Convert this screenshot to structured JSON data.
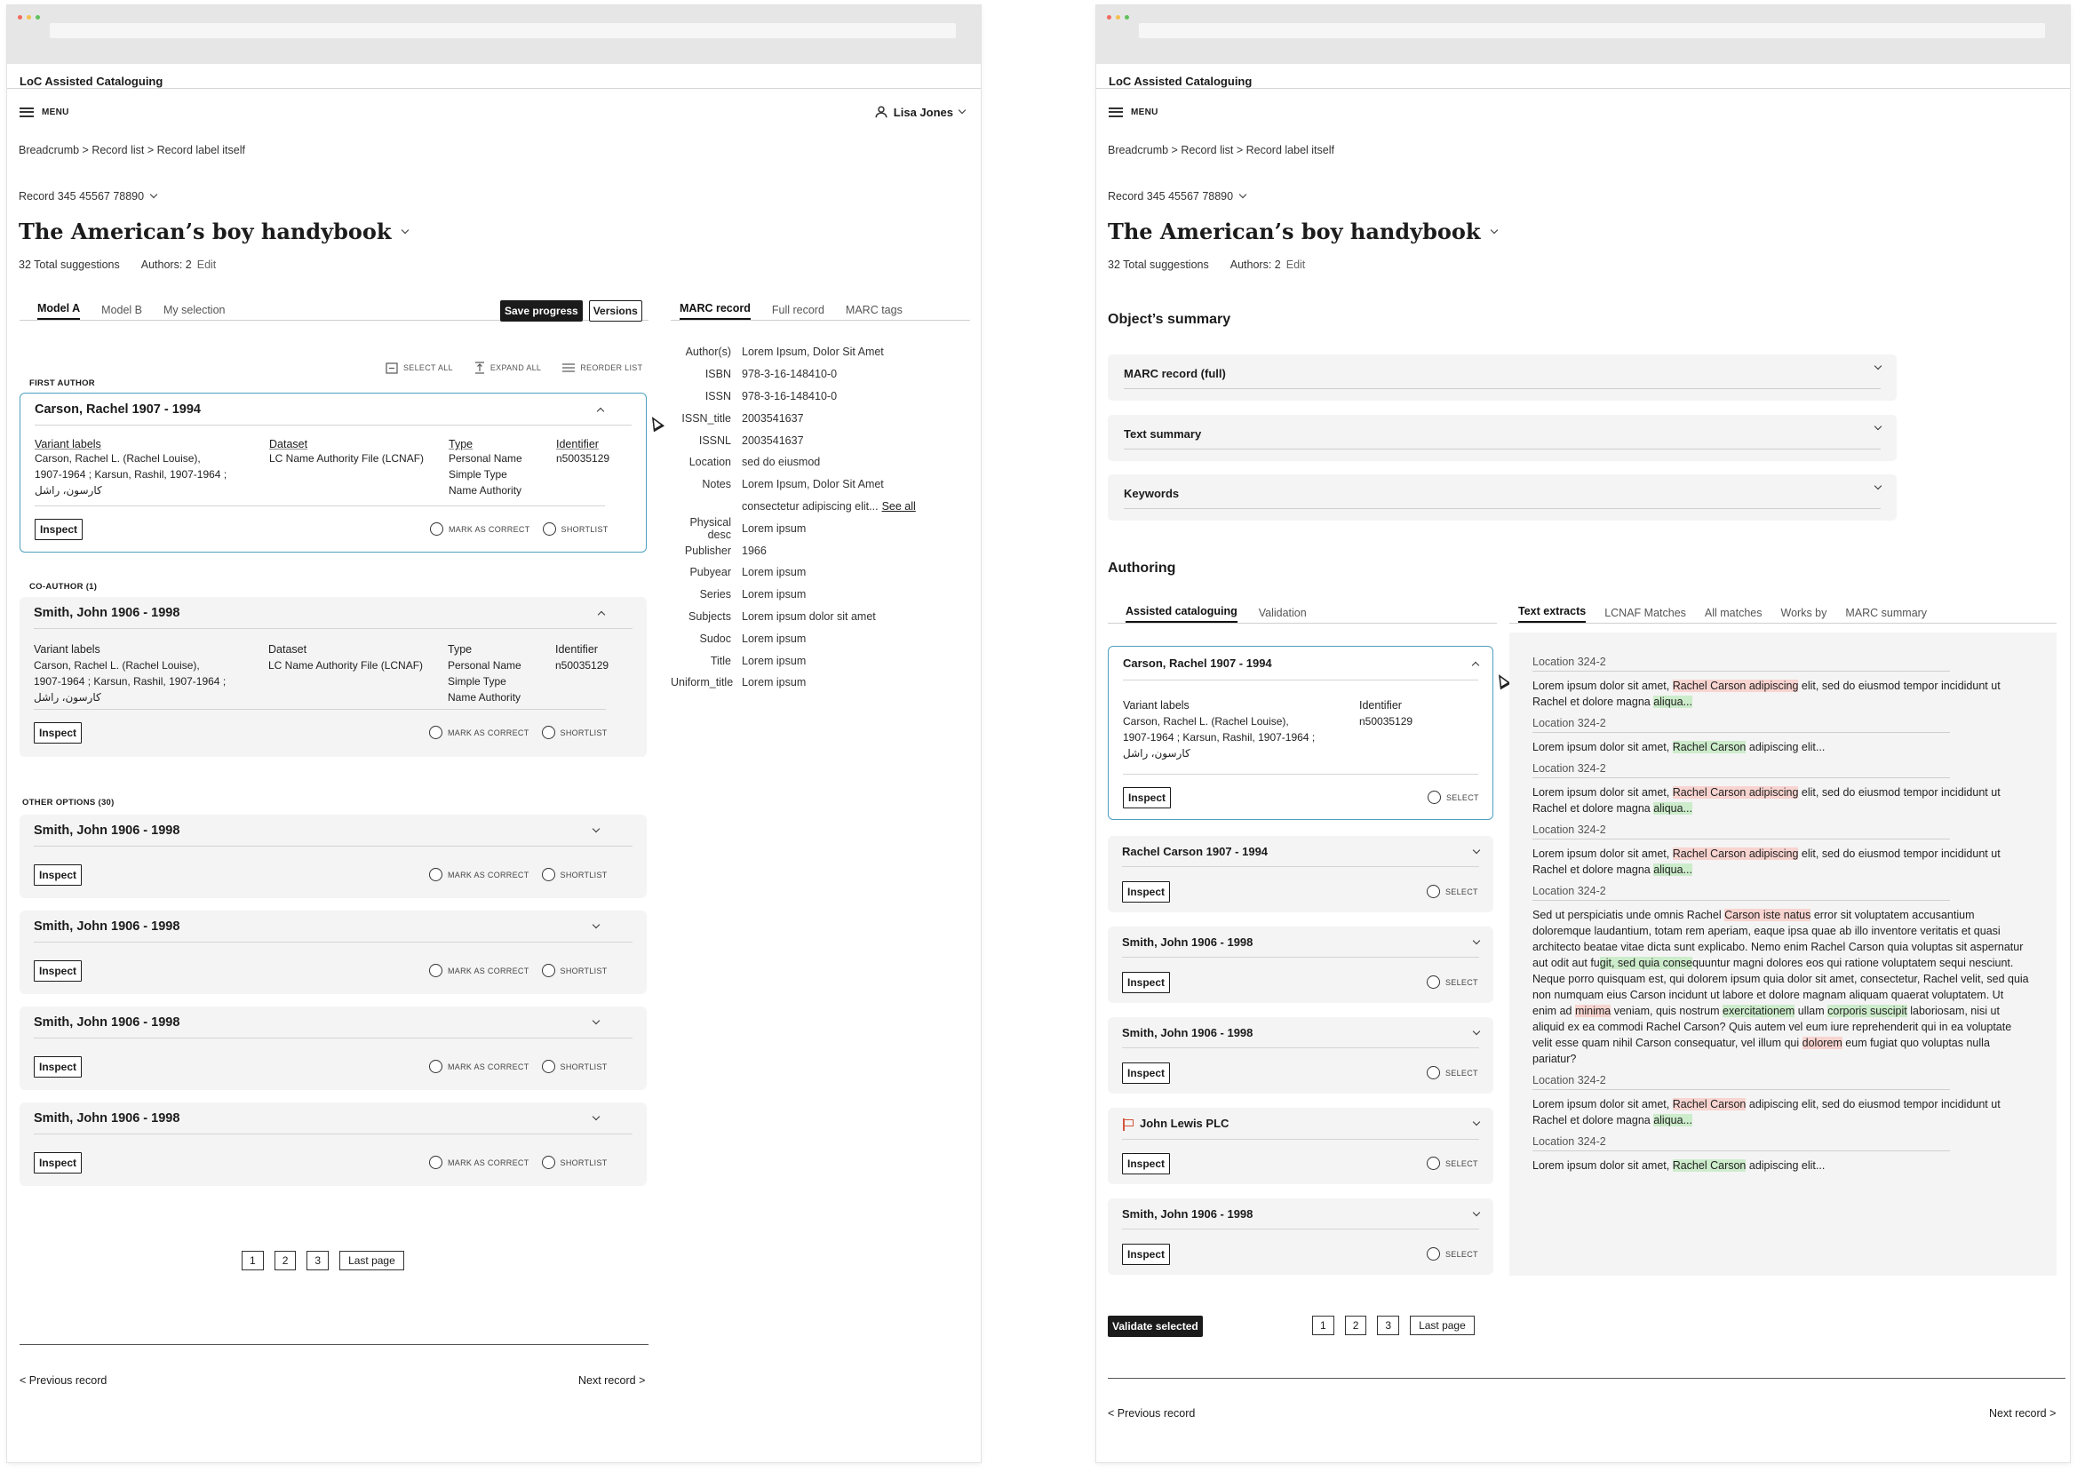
{
  "app": {
    "title": "LoC Assisted Cataloguing",
    "menu_label": "MENU",
    "user_name": "Lisa Jones"
  },
  "breadcrumb": "Breadcrumb > Record list > Record label itself",
  "record": {
    "id": "Record 345 45567 78890",
    "title": "The American’s boy handybook",
    "total_suggestions": "32 Total suggestions",
    "authors": "Authors: 2",
    "edit_label": "Edit"
  },
  "left": {
    "tabs": [
      "Model A",
      "Model B",
      "My selection"
    ],
    "save_progress": "Save progress",
    "versions": "Versions",
    "toolbar": {
      "select_all": "SELECT ALL",
      "expand_all": "EXPAND ALL",
      "reorder_list": "REORDER LIST"
    },
    "first_author_label": "FIRST AUTHOR",
    "coauthor_label": "CO-AUTHOR (1)",
    "other_options_label": "OTHER OPTIONS (30)",
    "field_headers": {
      "variant": "Variant labels",
      "dataset": "Dataset",
      "type": "Type",
      "identifier": "Identifier"
    },
    "detail_cards": [
      {
        "name": "Carson, Rachel 1907 - 1994",
        "variant_lines": [
          "Carson, Rachel L. (Rachel Louise),",
          "1907-1964 ; Karsun, Rashil, 1907-1964 ;",
          "كارسون، راشل"
        ],
        "dataset": "LC Name Authority File (LCNAF)",
        "type_lines": [
          "Personal Name",
          "Simple Type",
          "Name Authority"
        ],
        "identifier": "n50035129"
      },
      {
        "name": "Smith, John 1906 - 1998",
        "variant_lines": [
          "Carson, Rachel L. (Rachel Louise),",
          "1907-1964 ; Karsun, Rashil, 1907-1964 ;",
          "كارسون، راشل"
        ],
        "dataset": "LC Name Authority File (LCNAF)",
        "type_lines": [
          "Personal Name",
          "Simple Type",
          "Name Authority"
        ],
        "identifier": "n50035129"
      }
    ],
    "other_cards": [
      "Smith, John 1906 - 1998",
      "Smith, John 1906 - 1998",
      "Smith, John 1906 - 1998",
      "Smith, John 1906 - 1998"
    ],
    "inspect": "Inspect",
    "mark_correct": "MARK AS CORRECT",
    "shortlist": "SHORTLIST",
    "pages": [
      "1",
      "2",
      "3"
    ],
    "last_page": "Last page",
    "prev_record": "< Previous record",
    "next_record": "Next record >",
    "marc_tabs": [
      "MARC record",
      "Full record",
      "MARC tags"
    ],
    "marc_rows": [
      {
        "k": "Author(s)",
        "v": "Lorem Ipsum, Dolor Sit Amet"
      },
      {
        "k": "ISBN",
        "v": "978-3-16-148410-0"
      },
      {
        "k": "ISSN",
        "v": "978-3-16-148410-0"
      },
      {
        "k": "ISSN_title",
        "v": "2003541637"
      },
      {
        "k": "ISSNL",
        "v": "2003541637"
      },
      {
        "k": "Location",
        "v": "sed do eiusmod"
      },
      {
        "k": "Notes",
        "v": "Lorem Ipsum, Dolor Sit Amet"
      },
      {
        "k": "",
        "v": "consectetur adipiscing elit...",
        "link": "See all"
      },
      {
        "k": "Physical desc",
        "v": "Lorem ipsum"
      },
      {
        "k": "Publisher",
        "v": "1966"
      },
      {
        "k": "Pubyear",
        "v": "Lorem ipsum"
      },
      {
        "k": "Series",
        "v": "Lorem ipsum"
      },
      {
        "k": "Subjects",
        "v": "Lorem ipsum dolor sit amet"
      },
      {
        "k": "Sudoc",
        "v": "Lorem ipsum"
      },
      {
        "k": "Title",
        "v": "Lorem ipsum"
      },
      {
        "k": "Uniform_title",
        "v": "Lorem ipsum"
      }
    ]
  },
  "right": {
    "summary_heading": "Object’s summary",
    "accordions": [
      "MARC record (full)",
      "Text summary",
      "Keywords"
    ],
    "authoring_heading": "Authoring",
    "tabs": [
      "Assisted cataloguing",
      "Validation"
    ],
    "selected_card": {
      "name": "Carson, Rachel 1907 - 1994",
      "variant_header": "Variant labels",
      "variant_lines": [
        "Carson, Rachel L. (Rachel Louise),",
        "1907-1964 ; Karsun, Rashil, 1907-1964 ;",
        "كارسون، راشل"
      ],
      "identifier_header": "Identifier",
      "identifier": "n50035129"
    },
    "cards": [
      "Rachel Carson 1907 - 1994",
      "Smith, John 1906 - 1998",
      "Smith, John 1906 - 1998",
      "John Lewis PLC",
      "Smith, John 1906 - 1998"
    ],
    "inspect": "Inspect",
    "select": "SELECT",
    "validate_selected": "Validate selected",
    "pages": [
      "1",
      "2",
      "3"
    ],
    "last_page": "Last page",
    "prev_record": "< Previous record",
    "next_record": "Next record >",
    "extract_tabs": [
      "Text extracts",
      "LCNAF Matches",
      "All matches",
      "Works by",
      "MARC summary"
    ],
    "location_label": "Location 324-2",
    "extracts": [
      [
        {
          "t": "Lorem ipsum dolor sit amet, "
        },
        {
          "t": "Rachel Carson adipiscing",
          "h": "r"
        },
        {
          "t": " elit, sed do eiusmod tempor incididunt ut Rachel et dolore magna "
        },
        {
          "t": "aliqua...",
          "h": "g"
        }
      ],
      [
        {
          "t": "Lorem ipsum dolor sit amet, "
        },
        {
          "t": "Rachel Carson",
          "h": "g"
        },
        {
          "t": " adipiscing elit..."
        }
      ],
      [
        {
          "t": "Lorem ipsum dolor sit amet, "
        },
        {
          "t": "Rachel Carson adipiscing",
          "h": "r"
        },
        {
          "t": " elit, sed do eiusmod tempor incididunt ut Rachel et dolore magna "
        },
        {
          "t": "aliqua...",
          "h": "g"
        }
      ],
      [
        {
          "t": "Lorem ipsum dolor sit amet, "
        },
        {
          "t": "Rachel Carson adipiscing",
          "h": "r"
        },
        {
          "t": " elit, sed do eiusmod tempor incididunt ut Rachel et dolore magna "
        },
        {
          "t": "aliqua...",
          "h": "g"
        }
      ],
      [
        {
          "t": "Sed ut perspiciatis unde omnis Rachel "
        },
        {
          "t": "Carson iste natus",
          "h": "r"
        },
        {
          "t": " error sit voluptatem accusantium doloremque laudantium, totam rem aperiam, eaque ipsa quae ab illo inventore veritatis et quasi architecto beatae vitae dicta sunt explicabo. Nemo enim Rachel Carson quia voluptas sit aspernatur aut odit aut fu"
        },
        {
          "t": "git, sed quia conse",
          "h": "g"
        },
        {
          "t": "quuntur magni dolores eos qui ratione voluptatem sequi nesciunt. Neque porro quisquam est, qui dolorem ipsum quia dolor sit amet, consectetur, Rachel velit, sed quia non numquam eius Carson incidunt ut labore et dolore magnam aliquam quaerat voluptatem. Ut enim ad "
        },
        {
          "t": "minima",
          "h": "r"
        },
        {
          "t": " veniam, quis nostrum "
        },
        {
          "t": "exercitationem",
          "h": "g"
        },
        {
          "t": " ullam "
        },
        {
          "t": "corporis suscipit",
          "h": "g"
        },
        {
          "t": " laboriosam, nisi ut aliquid ex ea commodi Rachel Carson? Quis autem vel eum iure reprehenderit qui in ea voluptate velit esse quam nihil Carson consequatur, vel illum qui "
        },
        {
          "t": "dolorem",
          "h": "r"
        },
        {
          "t": " eum fugiat quo voluptas nulla pariatur?"
        }
      ],
      [
        {
          "t": "Lorem ipsum dolor sit amet, "
        },
        {
          "t": "Rachel Carson",
          "h": "r"
        },
        {
          "t": " adipiscing elit, sed do eiusmod tempor incididunt ut Rachel et dolore magna "
        },
        {
          "t": "aliqua...",
          "h": "g"
        }
      ],
      [
        {
          "t": "Lorem ipsum dolor sit amet, "
        },
        {
          "t": "Rachel Carson",
          "h": "g"
        },
        {
          "t": " adipiscing elit..."
        }
      ]
    ]
  }
}
